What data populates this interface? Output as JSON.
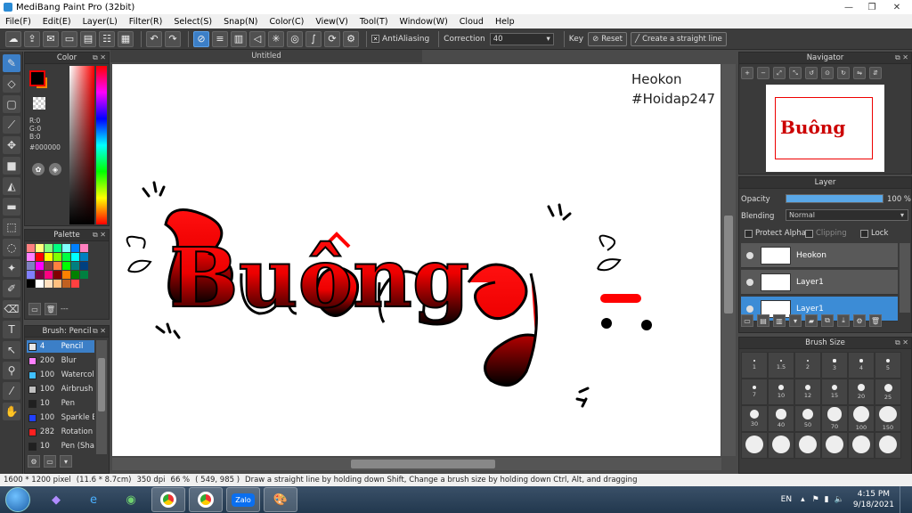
{
  "window": {
    "title": "MediBang Paint Pro (32bit)",
    "controls": [
      "—",
      "❐",
      "✕"
    ]
  },
  "menu": [
    "File(F)",
    "Edit(E)",
    "Layer(L)",
    "Filter(R)",
    "Select(S)",
    "Snap(N)",
    "Color(C)",
    "View(V)",
    "Tool(T)",
    "Window(W)",
    "Cloud",
    "Help"
  ],
  "toolbar": {
    "antialiasing_label": "AntiAliasing",
    "correction_label": "Correction",
    "correction_value": "40",
    "key_label": "Key",
    "reset_label": "Reset",
    "straight_line_label": "Create a straight line"
  },
  "color_panel": {
    "title": "Color",
    "r": "R:0",
    "g": "G:0",
    "b": "B:0",
    "hex": "#000000",
    "fg_color": "#000000",
    "bg_color": "#f38400"
  },
  "palette": {
    "title": "Palette",
    "more": "---",
    "colors": [
      "#ff8080",
      "#ffff80",
      "#80ff80",
      "#00ff80",
      "#80ffff",
      "#0080ff",
      "#ff80c0",
      "#ff80ff",
      "#ff0000",
      "#ffff00",
      "#80ff00",
      "#00ff40",
      "#00ffff",
      "#0080c0",
      "#8080c0",
      "#ff00ff",
      "#804040",
      "#ff8040",
      "#00ff00",
      "#008080",
      "#004080",
      "#8080ff",
      "#800040",
      "#ff0080",
      "#800000",
      "#ff8000",
      "#008000",
      "#008040",
      "#000000",
      "#ffffff",
      "#ffe0c0",
      "#ffc080",
      "#c06020",
      "#ff4040"
    ]
  },
  "brush_panel": {
    "title": "Brush: Pencil",
    "brushes": [
      {
        "size": "4",
        "name": "Pencil",
        "color": "#e8e8e8",
        "selected": true
      },
      {
        "size": "200",
        "name": "Blur",
        "color": "#ff80ff",
        "selected": false
      },
      {
        "size": "100",
        "name": "Watercolor",
        "color": "#40c0ff",
        "selected": false
      },
      {
        "size": "100",
        "name": "Airbrush",
        "color": "#c0c0c0",
        "selected": false
      },
      {
        "size": "10",
        "name": "Pen",
        "color": "#202020",
        "selected": false
      },
      {
        "size": "100",
        "name": "Sparkle B",
        "color": "#2040ff",
        "selected": false
      },
      {
        "size": "282",
        "name": "Rotation",
        "color": "#ff2020",
        "selected": false
      },
      {
        "size": "10",
        "name": "Pen (Sha",
        "color": "#202020",
        "selected": false
      }
    ]
  },
  "canvas": {
    "tab_title": "Untitled",
    "caption_line1": "Heokon",
    "caption_line2": "#Hoidap247",
    "lettering": "Buông"
  },
  "navigator": {
    "title": "Navigator",
    "thumb_text": "Buông"
  },
  "layer_panel": {
    "title": "Layer",
    "opacity_label": "Opacity",
    "opacity_value": "100 %",
    "opacity_fraction": 1.0,
    "blending_label": "Blending",
    "blending_value": "Normal",
    "protect_alpha": "Protect Alpha",
    "clipping": "Clipping",
    "lock": "Lock",
    "layers": [
      {
        "name": "Heokon",
        "selected": false
      },
      {
        "name": "Layer1",
        "selected": false
      },
      {
        "name": "Layer1",
        "selected": true
      }
    ]
  },
  "brush_size": {
    "title": "Brush Size",
    "sizes": [
      "1",
      "1.5",
      "2",
      "3",
      "4",
      "5",
      "7",
      "10",
      "12",
      "15",
      "20",
      "25",
      "30",
      "40",
      "50",
      "70",
      "100",
      "150",
      "",
      "",
      "",
      "",
      "",
      ""
    ]
  },
  "status": {
    "dimensions": "1600 * 1200 pixel",
    "physical": "(11.6 * 8.7cm)",
    "dpi": "350 dpi",
    "zoom": "66 %",
    "coords": "( 549, 985 )",
    "hint": "Draw a straight line by holding down Shift, Change a brush size by holding down Ctrl, Alt, and dragging"
  },
  "taskbar": {
    "lang": "EN",
    "time": "4:15 PM",
    "date": "9/18/2021",
    "apps": [
      "visual-studio-icon",
      "ie-icon",
      "game-icon",
      "chrome-icon",
      "chrome-alt-icon",
      "zalo-icon",
      "paint-icon"
    ],
    "zalo_label": "Zalo"
  }
}
